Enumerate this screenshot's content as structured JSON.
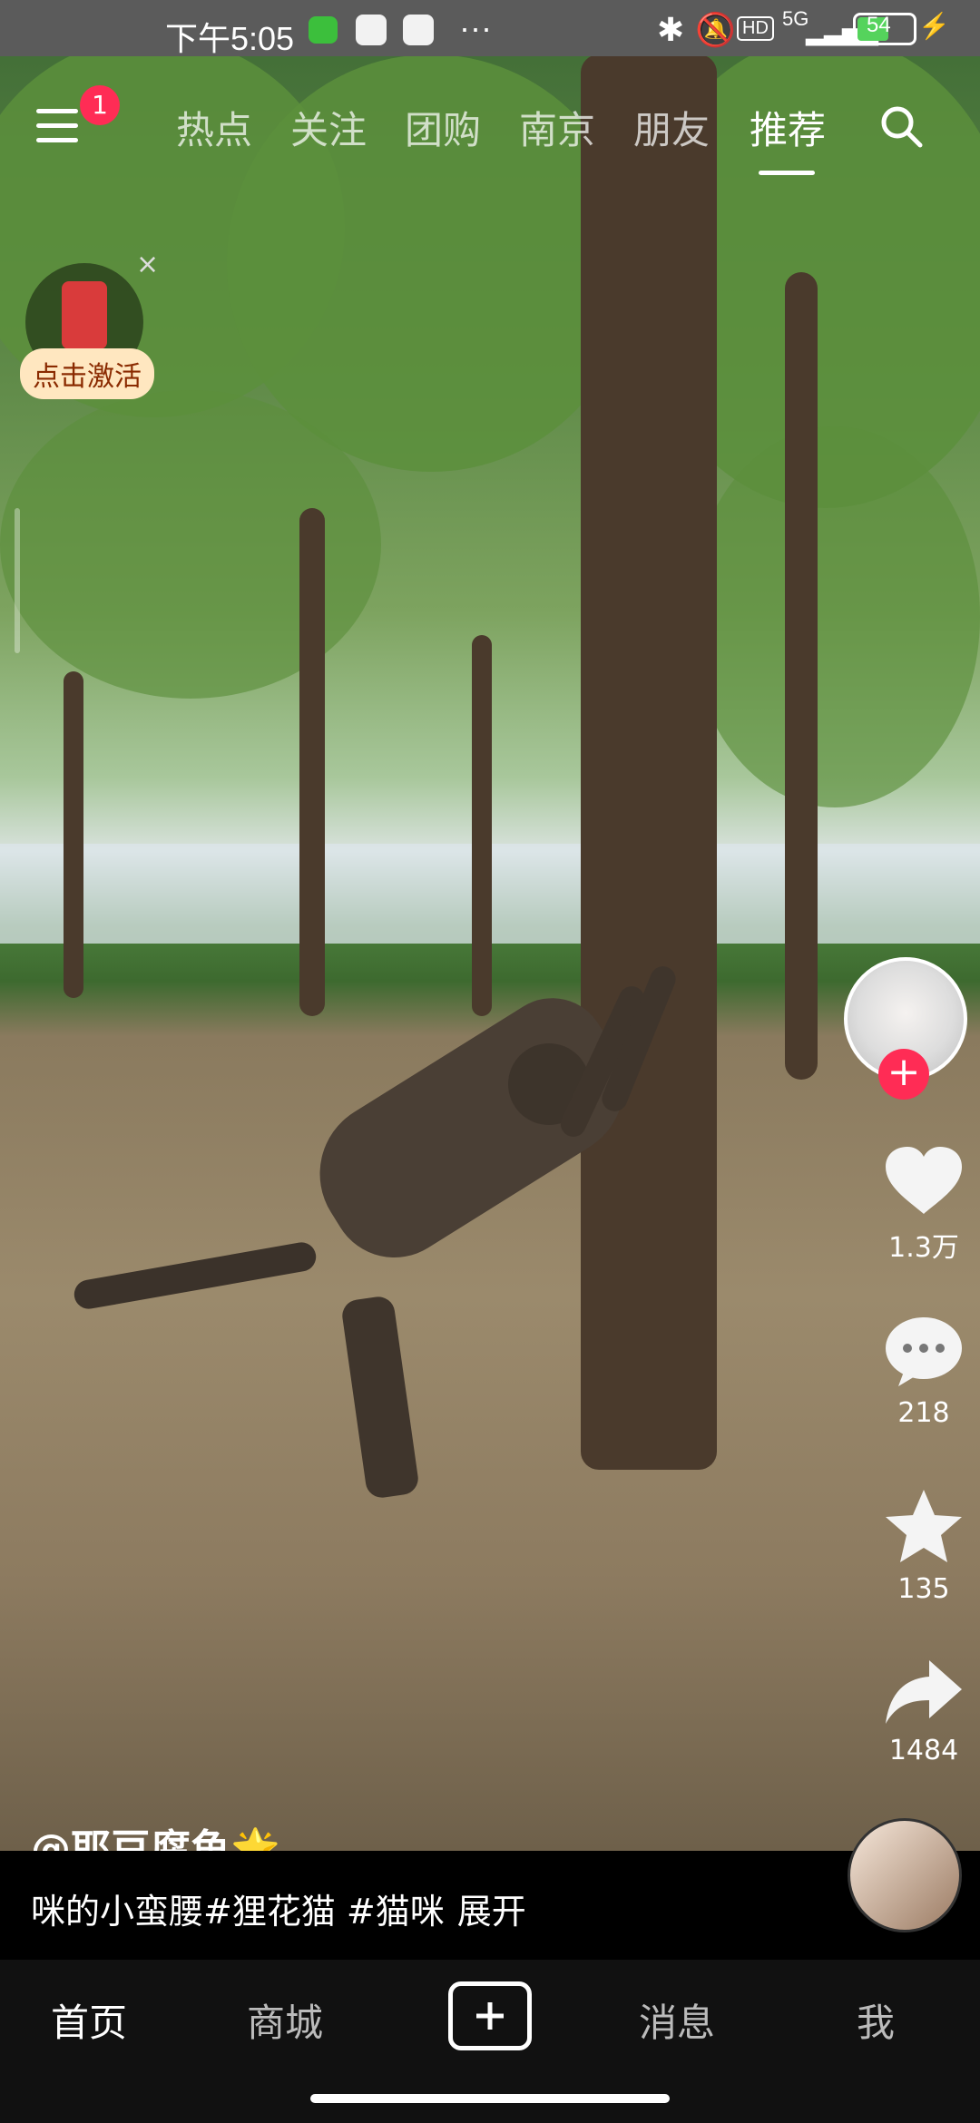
{
  "status_bar": {
    "time": "下午5:05",
    "network": "5G",
    "battery": "54"
  },
  "top_nav": {
    "badge_count": "1",
    "tabs": [
      {
        "label": "热点",
        "active": false
      },
      {
        "label": "关注",
        "active": false
      },
      {
        "label": "团购",
        "active": false
      },
      {
        "label": "南京",
        "active": false
      },
      {
        "label": "朋友",
        "active": false
      },
      {
        "label": "推荐",
        "active": true
      }
    ]
  },
  "promo": {
    "label": "点击激活",
    "close_icon": "close-icon"
  },
  "side_actions": {
    "like_count": "1.3万",
    "comment_count": "218",
    "favorite_count": "135",
    "share_count": "1484"
  },
  "post": {
    "author": "@耶豆腐鱼🌟",
    "caption": "咪的小蛮腰#狸花猫 #猫咪",
    "expand_label": "展开"
  },
  "bottom_nav": {
    "items": [
      {
        "label": "首页",
        "active": true
      },
      {
        "label": "商城",
        "active": false
      },
      {
        "label": "消息",
        "active": false
      },
      {
        "label": "我",
        "active": false
      }
    ]
  },
  "colors": {
    "accent": "#ff2c55",
    "status_bar_bg": "#5b5b5b",
    "bottom_bar_bg": "#111111"
  }
}
